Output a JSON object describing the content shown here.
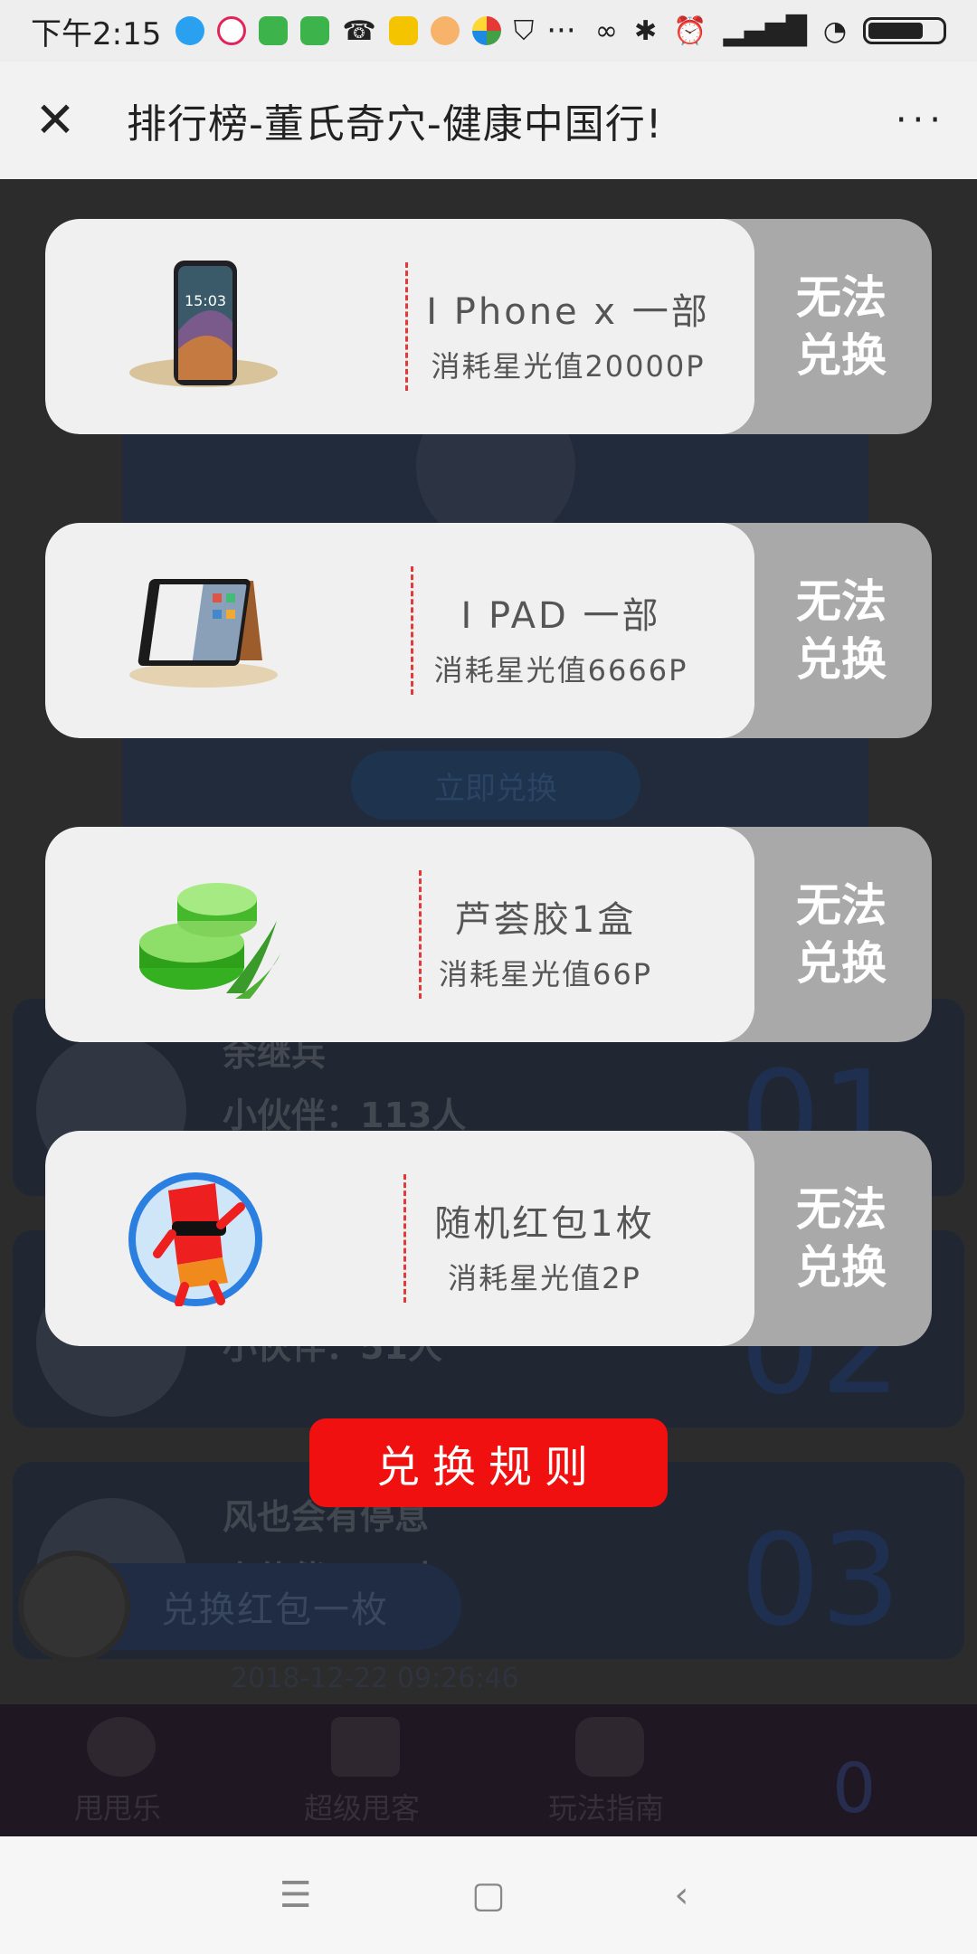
{
  "status_bar": {
    "time": "下午2:15",
    "app_icons": [
      "blue-app-icon",
      "red-play-icon",
      "green-qu-icon",
      "green-qu-icon",
      "missed-call-icon",
      "yellow-app-icon",
      "face-app-icon",
      "pinwheel-icon",
      "shield-icon"
    ],
    "more": "···"
  },
  "nav": {
    "title": "排行榜-董氏奇穴-健康中国行!",
    "more_label": "···"
  },
  "background": {
    "button_label": "立即兑换",
    "ranks": [
      {
        "name": "余继兵",
        "count": "小伙伴：113人",
        "num": "01"
      },
      {
        "name": "",
        "count": "小伙伴：51人",
        "num": "02"
      },
      {
        "name": "风也会有停息",
        "count": "小伙伴：51人",
        "num": "03"
      }
    ],
    "toast": "兑换红包一枚",
    "timestamp": "2018-12-22 09:26:46",
    "tabs": [
      "甩甩乐",
      "超级甩客",
      "玩法指南"
    ],
    "balance": "0"
  },
  "prizes": [
    {
      "name": "I Phone x 一部",
      "cost": "消耗星光值20000P",
      "status": "无法兑换",
      "icon": "phone-image"
    },
    {
      "name": "I PAD 一部",
      "cost": "消耗星光值6666P",
      "status": "无法兑换",
      "icon": "tablet-image"
    },
    {
      "name": "芦荟胶1盒",
      "cost": "消耗星光值66P",
      "status": "无法兑换",
      "icon": "aloe-gel-image"
    },
    {
      "name": "随机红包1枚",
      "cost": "消耗星光值2P",
      "status": "无法兑换",
      "icon": "red-envelope-image"
    }
  ],
  "rules_button": "兑换规则",
  "colors": {
    "accent_red": "#f01010",
    "card_bg": "#f0f0f0",
    "disabled_gray": "#a9a9a9",
    "divider_red": "#e03a3a"
  }
}
